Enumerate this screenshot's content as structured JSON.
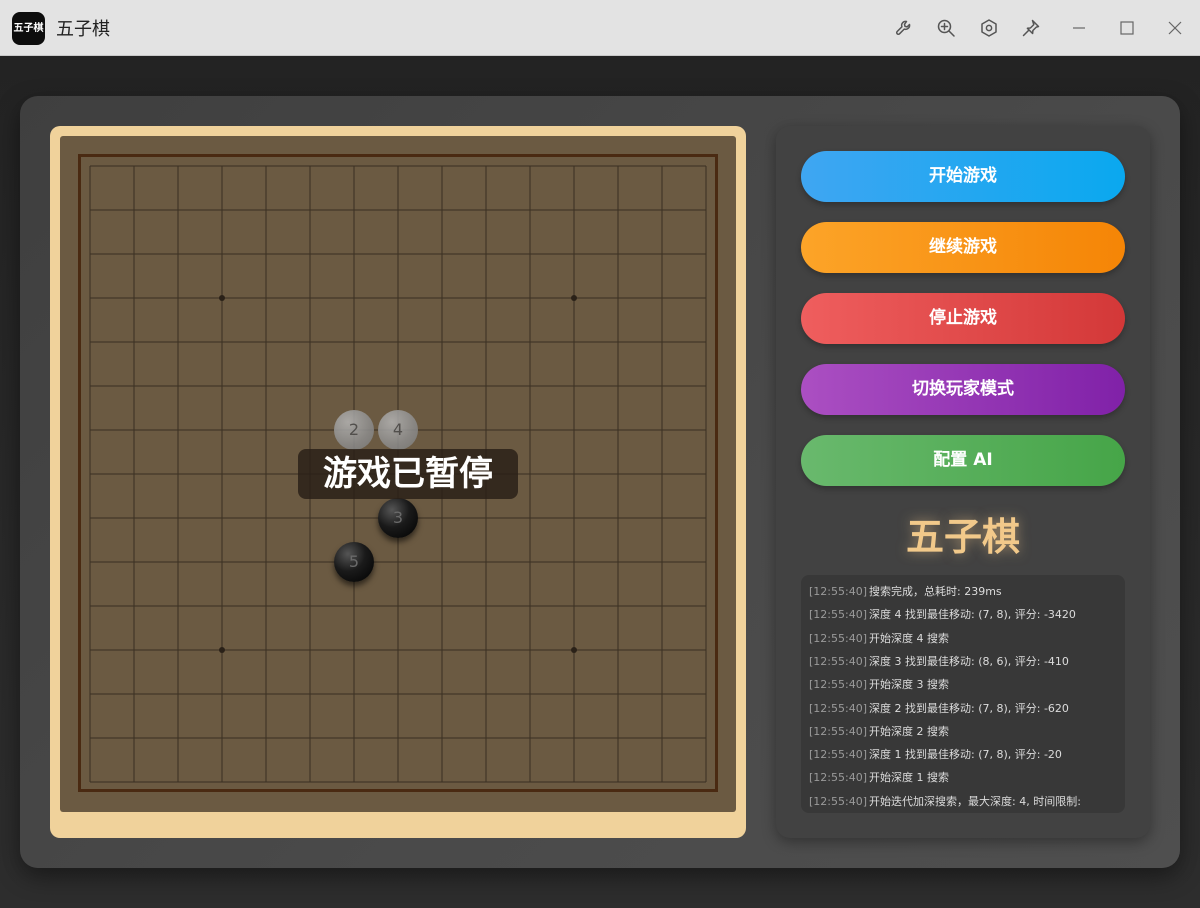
{
  "window": {
    "logo_text": "五子棋",
    "title": "五子棋",
    "toolbar_icons": [
      "wrench-icon",
      "zoom-in-icon",
      "settings-hex-icon",
      "pin-icon"
    ],
    "window_controls": [
      "minimize-icon",
      "maximize-icon",
      "close-icon"
    ]
  },
  "board": {
    "size": 15,
    "star_points": [
      [
        3,
        3
      ],
      [
        11,
        3
      ],
      [
        3,
        11
      ],
      [
        11,
        11
      ]
    ],
    "stones": [
      {
        "col": 6,
        "row": 6,
        "color": "white",
        "number": "2"
      },
      {
        "col": 7,
        "row": 6,
        "color": "white",
        "number": "4"
      },
      {
        "col": 7,
        "row": 8,
        "color": "black",
        "number": "3"
      },
      {
        "col": 6,
        "row": 9,
        "color": "black",
        "number": "5"
      }
    ],
    "status_text": "游戏已暂停"
  },
  "controls": {
    "start_label": "开始游戏",
    "continue_label": "继续游戏",
    "stop_label": "停止游戏",
    "switch_label": "切换玩家模式",
    "config_label": "配置 AI"
  },
  "panel_title": "五子棋",
  "log": [
    {
      "time": "[12:55:40]",
      "message": "搜索完成，总耗时: 239ms"
    },
    {
      "time": "[12:55:40]",
      "message": "深度 4 找到最佳移动: (7, 8), 评分: -3420"
    },
    {
      "time": "[12:55:40]",
      "message": "开始深度 4 搜索"
    },
    {
      "time": "[12:55:40]",
      "message": "深度 3 找到最佳移动: (8, 6), 评分: -410"
    },
    {
      "time": "[12:55:40]",
      "message": "开始深度 3 搜索"
    },
    {
      "time": "[12:55:40]",
      "message": "深度 2 找到最佳移动: (7, 8), 评分: -620"
    },
    {
      "time": "[12:55:40]",
      "message": "开始深度 2 搜索"
    },
    {
      "time": "[12:55:40]",
      "message": "深度 1 找到最佳移动: (7, 8), 评分: -20"
    },
    {
      "time": "[12:55:40]",
      "message": "开始深度 1 搜索"
    },
    {
      "time": "[12:55:40]",
      "message": "开始迭代加深搜索，最大深度: 4, 时间限制:"
    }
  ]
}
